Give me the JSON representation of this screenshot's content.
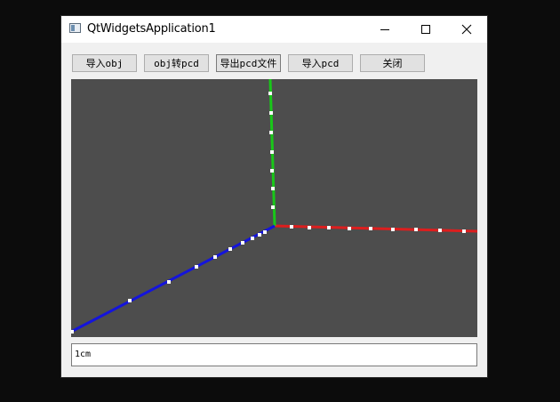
{
  "window": {
    "title": "QtWidgetsApplication1"
  },
  "icons": {
    "app": "app-window-icon",
    "minimize": "minimize-icon",
    "maximize": "maximize-icon",
    "close": "close-icon"
  },
  "toolbar": {
    "import_obj": "导入obj",
    "obj_to_pcd": "obj转pcd",
    "export_pcd": "导出pcd文件",
    "import_pcd": "导入pcd",
    "close": "关闭"
  },
  "viewport": {
    "background_color": "#4d4d4d",
    "axes": [
      {
        "name": "x",
        "color": "#dd1e1e"
      },
      {
        "name": "y",
        "color": "#19c719"
      },
      {
        "name": "z",
        "color": "#1414dc"
      }
    ]
  },
  "scale_field": {
    "value": "1cm"
  }
}
